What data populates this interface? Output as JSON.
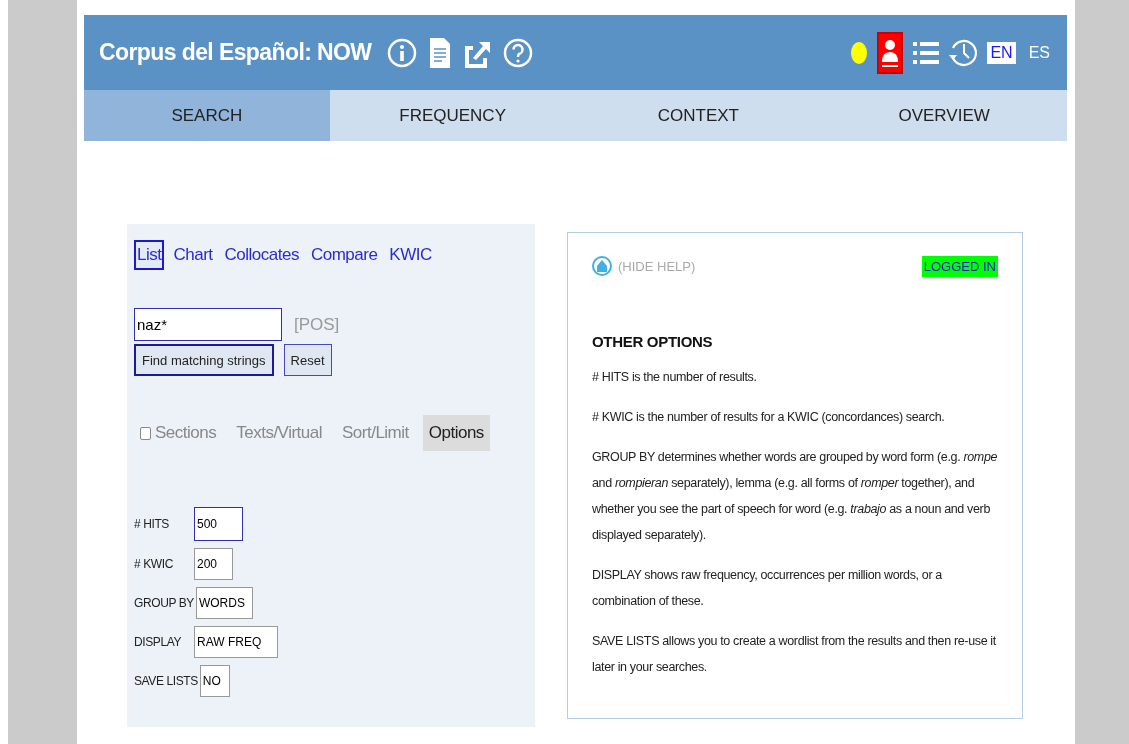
{
  "header": {
    "title": "Corpus del Español: NOW",
    "languages": [
      {
        "label": "EN",
        "selected": true
      },
      {
        "label": "ES",
        "selected": false
      }
    ]
  },
  "tabs": [
    {
      "label": "SEARCH",
      "selected": true
    },
    {
      "label": "FREQUENCY",
      "selected": false
    },
    {
      "label": "CONTEXT",
      "selected": false
    },
    {
      "label": "OVERVIEW",
      "selected": false
    }
  ],
  "search_types": [
    {
      "label": "List",
      "selected": true
    },
    {
      "label": "Chart",
      "selected": false
    },
    {
      "label": "Collocates",
      "selected": false
    },
    {
      "label": "Compare",
      "selected": false
    },
    {
      "label": "KWIC",
      "selected": false
    }
  ],
  "search": {
    "value": "naz*",
    "pos_label": "[POS]",
    "buttons": [
      "Find matching strings",
      "Reset"
    ]
  },
  "option_tabs": [
    {
      "kind": "checkbox",
      "label": "Sections",
      "checked": false,
      "selected": false
    },
    {
      "kind": "tab",
      "label": "Texts/Virtual",
      "selected": false
    },
    {
      "kind": "tab",
      "label": "Sort/Limit",
      "selected": false
    },
    {
      "kind": "tab",
      "label": "Options",
      "selected": true
    }
  ],
  "fields": [
    {
      "label": "# HITS",
      "value": "500",
      "focused": true
    },
    {
      "label": "# KWIC",
      "value": "200",
      "focused": false
    },
    {
      "label": "GROUP BY",
      "value": "WORDS",
      "focused": false
    },
    {
      "label": "DISPLAY",
      "value": "RAW FREQ",
      "focused": false
    },
    {
      "label": "SAVE LISTS",
      "value": "NO",
      "focused": false
    }
  ],
  "help": {
    "hide_label": "(HIDE HELP)",
    "status": "LOGGED IN",
    "heading": "OTHER OPTIONS",
    "paragraphs": [
      "# HITS is the number of results.",
      "# KWIC is the number of results for a KWIC (concordances) search.",
      "GROUP BY determines whether words are grouped by word form (e.g. *rompe* and *rompieran* separately), lemma (e.g. all forms of *romper* together), and whether you see the part of speech for word (e.g. *trabajo* as a noun and verb displayed separately).",
      "DISPLAY shows raw frequency, occurrences per million words, or a combination of these.",
      "SAVE LISTS allows you to create a wordlist from the results and then re-use it later in your searches."
    ]
  }
}
